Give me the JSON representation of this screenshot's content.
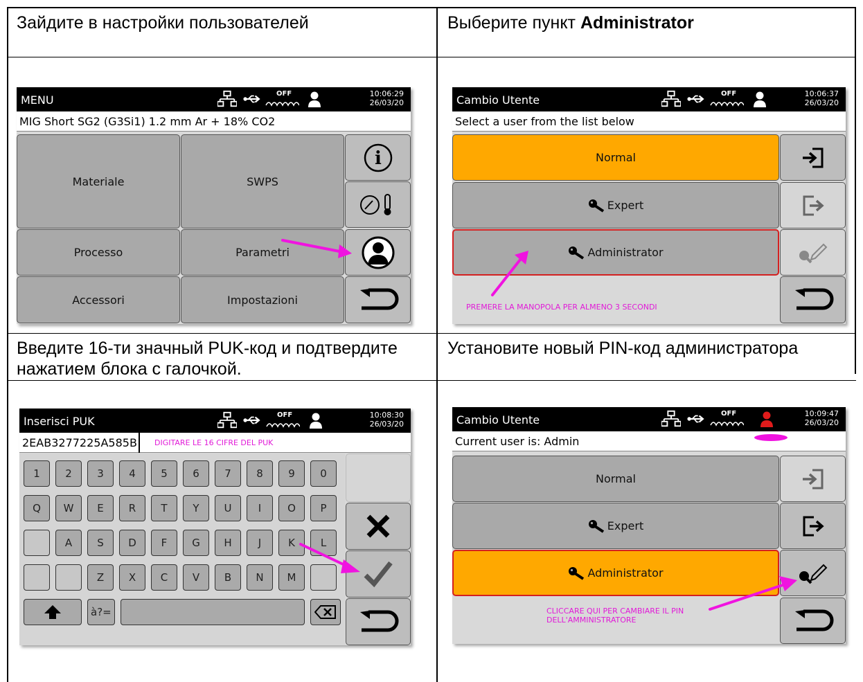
{
  "captions": {
    "tl": "Зайдите в настройки пользователей",
    "tr_prefix": "Выберите пункт ",
    "tr_bold": "Administrator",
    "bl": "Введите 16-ти значный PUK-код и подтвердите нажатием блока с галочкой.",
    "br": "Установите новый PIN-код администратора"
  },
  "status": {
    "off": "OFF"
  },
  "screen1": {
    "title": "MENU",
    "time": "10:06:29",
    "date": "26/03/20",
    "subline": "MIG Short  SG2 (G3Si1)  1.2 mm  Ar + 18% CO2",
    "buttons": [
      "Materiale",
      "SWPS",
      "Processo",
      "Parametri",
      "Accessori",
      "Impostazioni"
    ]
  },
  "screen2": {
    "title": "Cambio Utente",
    "time": "10:06:37",
    "date": "26/03/20",
    "subline": "Select a user from the list below",
    "users": [
      "Normal",
      "Expert",
      "Administrator"
    ],
    "note": "PREMERE LA MANOPOLA PER ALMENO 3 SECONDI"
  },
  "screen3": {
    "title": "Inserisci PUK",
    "time": "10:08:30",
    "date": "26/03/20",
    "puk_value": "2EAB3277225A585B",
    "note": "DIGITARE LE 16 CIFRE DEL PUK",
    "row1": [
      "1",
      "2",
      "3",
      "4",
      "5",
      "6",
      "7",
      "8",
      "9",
      "0"
    ],
    "row2": [
      "Q",
      "W",
      "E",
      "R",
      "T",
      "Y",
      "U",
      "I",
      "O",
      "P"
    ],
    "row3": [
      "",
      "A",
      "S",
      "D",
      "F",
      "G",
      "H",
      "J",
      "K",
      "L"
    ],
    "row4": [
      "",
      "",
      "Z",
      "X",
      "C",
      "V",
      "B",
      "N",
      "M",
      ""
    ],
    "symbols_key": "à?="
  },
  "screen4": {
    "title": "Cambio Utente",
    "time": "10:09:47",
    "date": "26/03/20",
    "subline": "Current user is: Admin",
    "users": [
      "Normal",
      "Expert",
      "Administrator"
    ],
    "note_line1": "CLICCARE QUI PER CAMBIARE IL PIN",
    "note_line2": "DELL'AMMINISTRATORE"
  },
  "colors": {
    "accent_orange": "#ffa800",
    "annotation_pink": "#f013e0",
    "selected_border": "#d32020"
  }
}
